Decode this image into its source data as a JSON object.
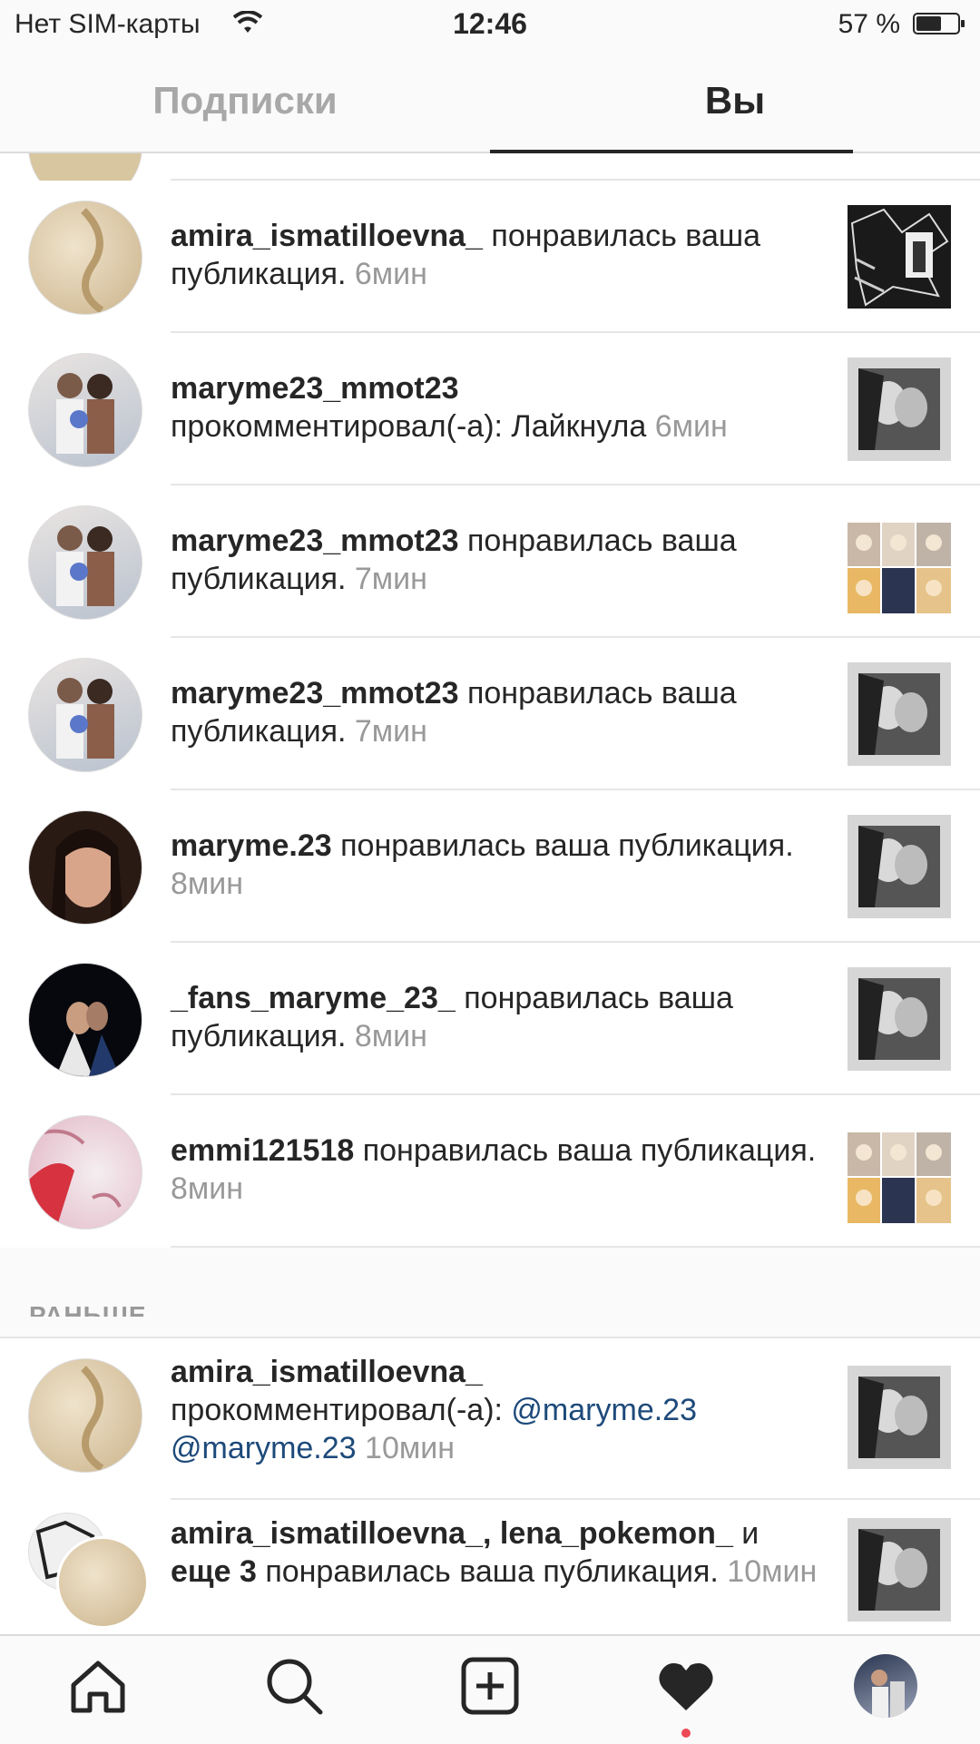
{
  "status_bar": {
    "carrier": "Нет SIM-карты",
    "time": "12:46",
    "battery": "57 %"
  },
  "tabs": {
    "following": "Подписки",
    "you": "Вы"
  },
  "notifications": [
    {
      "user": "amira_ismatilloevna_",
      "action": " понравилась ваша публикация. ",
      "time": "6мин",
      "avatar": "sand",
      "thumb": "collage"
    },
    {
      "user": "maryme23_mmot23",
      "action": " прокомментировал(-а): Лайкнула ",
      "time": "6мин",
      "avatar": "couple",
      "thumb": "bw"
    },
    {
      "user": "maryme23_mmot23",
      "action": " понравилась ваша публикация. ",
      "time": "7мин",
      "avatar": "couple",
      "thumb": "grid"
    },
    {
      "user": "maryme23_mmot23",
      "action": " понравилась ваша публикация. ",
      "time": "7мин",
      "avatar": "couple",
      "thumb": "bw"
    },
    {
      "user": "maryme.23",
      "action": " понравилась ваша публикация. ",
      "time": "8мин",
      "avatar": "face",
      "thumb": "bw"
    },
    {
      "user": "_fans_maryme_23_",
      "action": " понравилась ваша публикация. ",
      "time": "8мин",
      "avatar": "dark",
      "thumb": "bw"
    },
    {
      "user": "emmi121518",
      "action": " понравилась ваша публикация. ",
      "time": "8мин",
      "avatar": "pink",
      "thumb": "grid"
    }
  ],
  "earlier": {
    "header": "РАНЬШЕ",
    "item1": {
      "user": "amira_ismatilloevna_",
      "action": " прокомментировал(-а): ",
      "mention1": "@maryme.23",
      "mention2": "@maryme.23",
      "time": "10мин"
    },
    "item2": {
      "user1": "amira_ismatilloevna_",
      "sep": ", ",
      "user2": "lena_pokemon_",
      "conj": " и ",
      "user3": "еще 3",
      "action": " понравилась ваша публикация. ",
      "time": "10мин"
    }
  },
  "bottom_nav": {
    "items": [
      "home",
      "search",
      "add",
      "activity",
      "profile"
    ]
  },
  "colors": {
    "mention": "#1d4a7a",
    "time": "#999999",
    "notification_dot": "#ed4956"
  }
}
